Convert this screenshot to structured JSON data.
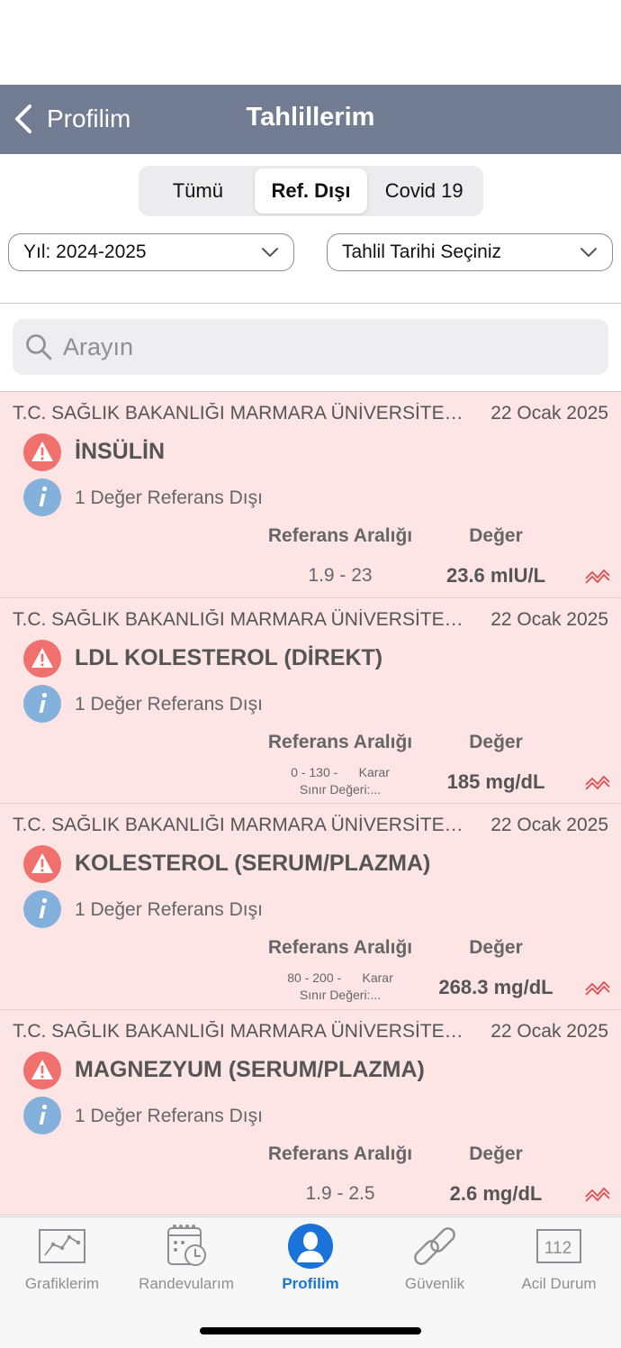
{
  "header": {
    "back_label": "Profilim",
    "title": "Tahlillerim"
  },
  "segments": [
    {
      "label": "Tümü",
      "active": false
    },
    {
      "label": "Ref. Dışı",
      "active": true
    },
    {
      "label": "Covid 19",
      "active": false
    }
  ],
  "filters": {
    "year": "Yıl: 2024-2025",
    "date": "Tahlil Tarihi Seçiniz"
  },
  "search": {
    "placeholder": "Arayın"
  },
  "results": [
    {
      "institution": "T.C. SAĞLIK BAKANLIĞI MARMARA ÜNİVERSİTESİ PENDİK EĞİTİM VE ARAŞTIRMA HASTANESİ",
      "date": "22 Ocak 2025",
      "name": "İNSÜLİN",
      "info": "1 Değer Referans Dışı",
      "ref_header": "Referans Aralığı",
      "value_header": "Değer",
      "ref_range": "1.9 - 23",
      "ref_range_line2": "",
      "value": "23.6 mIU/L"
    },
    {
      "institution": "T.C. SAĞLIK BAKANLIĞI MARMARA ÜNİVERSİTESİ PENDİK EĞİTİM VE ARAŞTIRMA HASTANESİ",
      "date": "22 Ocak 2025",
      "name": "LDL KOLESTEROL (DİREKT)",
      "info": "1 Değer Referans Dışı",
      "ref_header": "Referans Aralığı",
      "value_header": "Değer",
      "ref_range": "0 - 130 -      Karar",
      "ref_range_line2": "Sınır Değeri:...",
      "value": "185 mg/dL"
    },
    {
      "institution": "T.C. SAĞLIK BAKANLIĞI MARMARA ÜNİVERSİTESİ PENDİK EĞİTİM VE ARAŞTIRMA HASTANESİ",
      "date": "22 Ocak 2025",
      "name": "KOLESTEROL (SERUM/PLAZMA)",
      "info": "1 Değer Referans Dışı",
      "ref_header": "Referans Aralığı",
      "value_header": "Değer",
      "ref_range": "80 - 200 -      Karar",
      "ref_range_line2": "Sınır Değeri:...",
      "value": "268.3 mg/dL"
    },
    {
      "institution": "T.C. SAĞLIK BAKANLIĞI MARMARA ÜNİVERSİTESİ PENDİK EĞİTİM VE ARAŞTIRMA HASTANESİ",
      "date": "22 Ocak 2025",
      "name": "MAGNEZYUM (SERUM/PLAZMA)",
      "info": "1 Değer Referans Dışı",
      "ref_header": "Referans Aralığı",
      "value_header": "Değer",
      "ref_range": "1.9 - 2.5",
      "ref_range_line2": "",
      "value": "2.6 mg/dL"
    }
  ],
  "tabs": [
    {
      "label": "Grafiklerim",
      "icon": "chart-icon",
      "active": false
    },
    {
      "label": "Randevularım",
      "icon": "calendar-clock-icon",
      "active": false
    },
    {
      "label": "Profilim",
      "icon": "profile-icon",
      "active": true
    },
    {
      "label": "Güvenlik",
      "icon": "link-icon",
      "active": false
    },
    {
      "label": "Acil Durum",
      "icon": "emergency-112-icon",
      "badge": "112",
      "active": false
    }
  ],
  "colors": {
    "navbar": "#727c93",
    "card_background": "#fde5e5",
    "warning": "#f0706e",
    "info": "#84b0dc",
    "trend": "#e05050",
    "tab_active": "#1a73d9"
  }
}
